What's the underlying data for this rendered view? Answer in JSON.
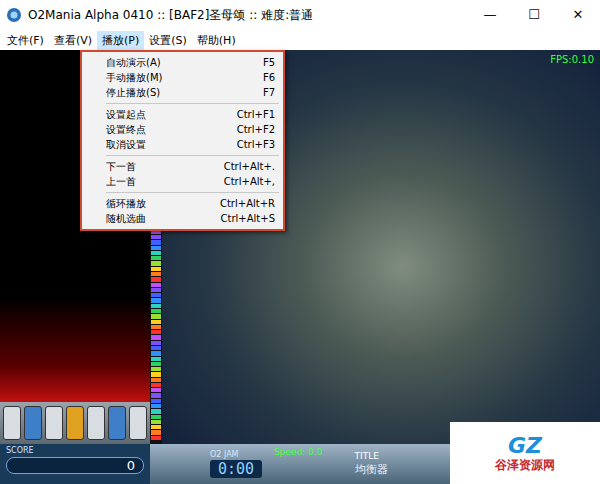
{
  "window": {
    "title": "O2Mania Alpha 0410 :: [BAF2]圣母颂 :: 难度:普通",
    "controls": [
      "—",
      "☐",
      "✕"
    ]
  },
  "menu_bar": [
    {
      "label": "文件(F)",
      "selected": false
    },
    {
      "label": "查看(V)",
      "selected": false
    },
    {
      "label": "播放(P)",
      "selected": true
    },
    {
      "label": "设置(S)",
      "selected": false
    },
    {
      "label": "帮助(H)",
      "selected": false
    }
  ],
  "dropdown": {
    "groups": [
      [
        {
          "label": "自动演示(A)",
          "shortcut": "F5"
        },
        {
          "label": "手动播放(M)",
          "shortcut": "F6"
        },
        {
          "label": "停止播放(S)",
          "shortcut": "F7"
        }
      ],
      [
        {
          "label": "设置起点",
          "shortcut": "Ctrl+F1"
        },
        {
          "label": "设置终点",
          "shortcut": "Ctrl+F2"
        },
        {
          "label": "取消设置",
          "shortcut": "Ctrl+F3"
        }
      ],
      [
        {
          "label": "下一首",
          "shortcut": "Ctrl+Alt+."
        },
        {
          "label": "上一首",
          "shortcut": "Ctrl+Alt+,"
        }
      ],
      [
        {
          "label": "循环播放",
          "shortcut": "Ctrl+Alt+R"
        },
        {
          "label": "随机选曲",
          "shortcut": "Ctrl+Alt+S"
        }
      ]
    ]
  },
  "game": {
    "fps": "FPS:0.10",
    "keys": [
      {
        "color": "#d8dde2"
      },
      {
        "color": "#3f7fc8"
      },
      {
        "color": "#d8dde2"
      },
      {
        "color": "#e0a020"
      },
      {
        "color": "#d8dde2"
      },
      {
        "color": "#3f7fc8"
      },
      {
        "color": "#d8dde2"
      }
    ],
    "hud": {
      "score_label": "SCORE",
      "score": "0",
      "brand": "O2 JAM",
      "speed": "Speed: 0.0",
      "time": "0:00",
      "title_label": "TITLE",
      "equalizer": "均衡器"
    }
  },
  "watermark": {
    "logo": "GZ",
    "text": "谷泽资源网"
  }
}
